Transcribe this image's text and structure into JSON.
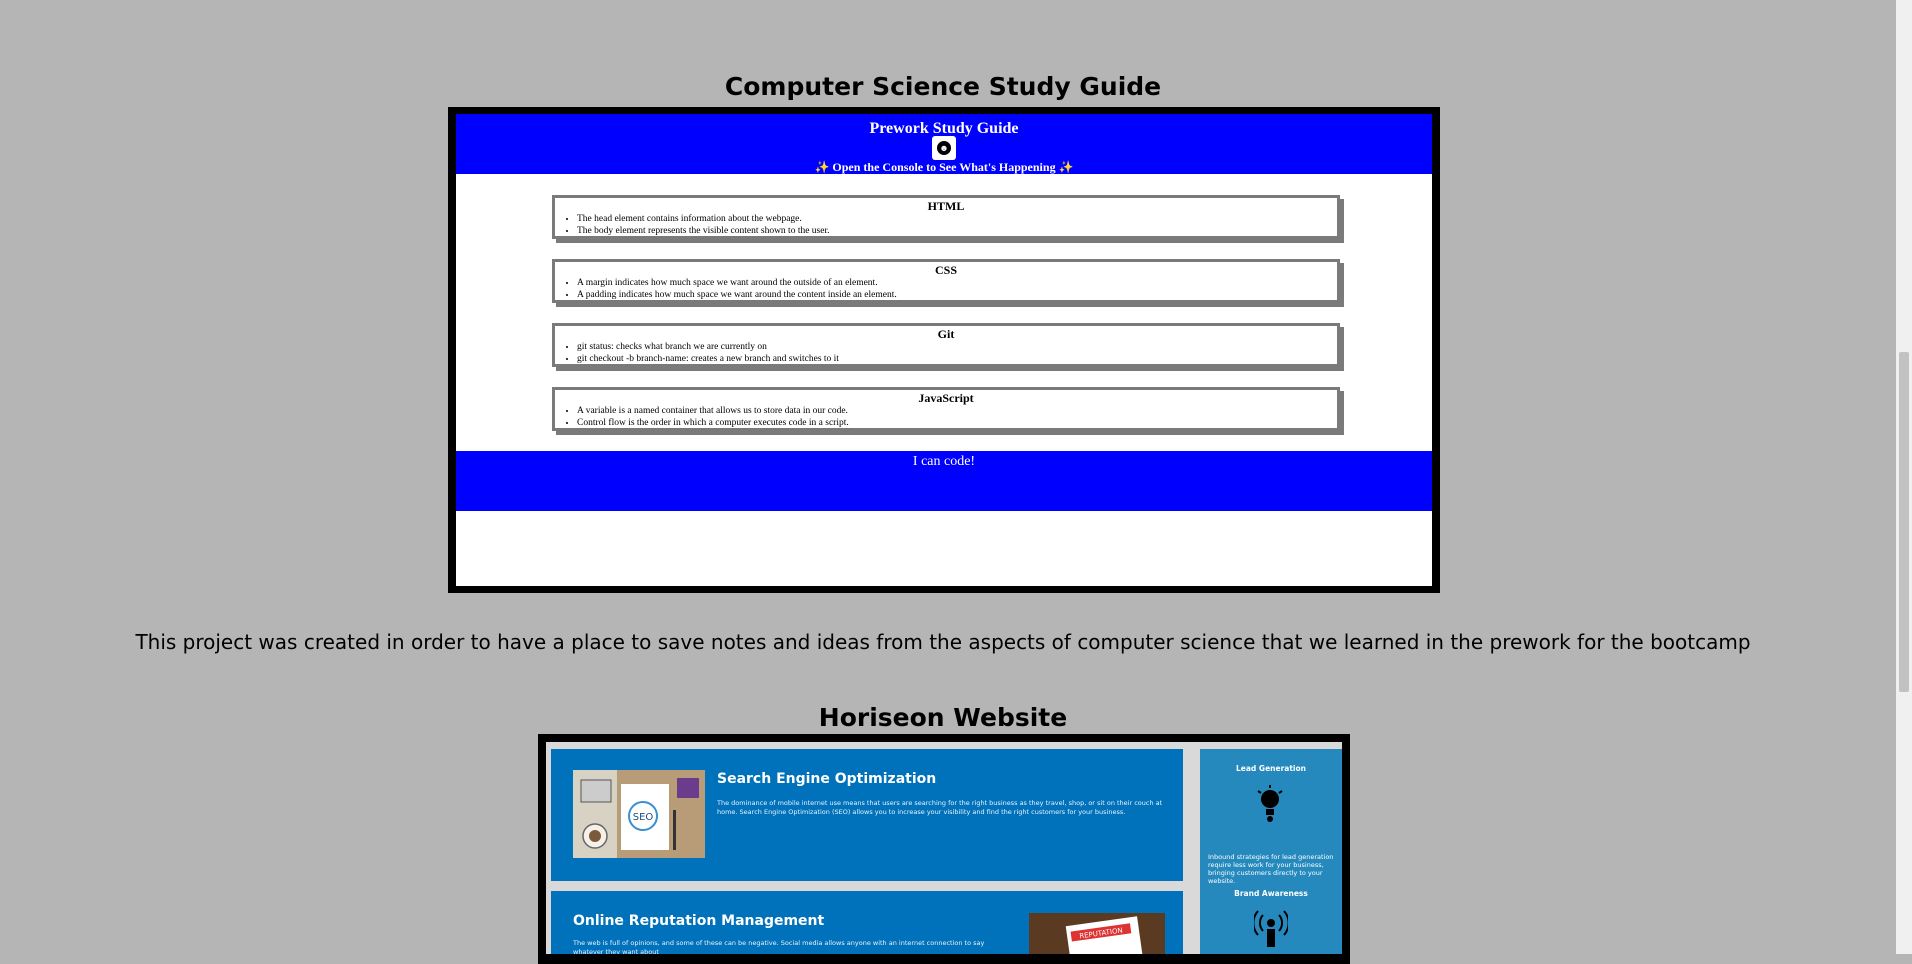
{
  "projects": [
    {
      "title": "Computer Science Study Guide",
      "preview": {
        "header_title": "Prework Study Guide",
        "header_subtitle": "✨ Open the Console to See What's Happening ✨",
        "cards": [
          {
            "title": "HTML",
            "items": [
              "The head element contains information about the webpage.",
              "The body element represents the visible content shown to the user."
            ]
          },
          {
            "title": "CSS",
            "items": [
              "A margin indicates how much space we want around the outside of an element.",
              "A padding indicates how much space we want around the content inside an element."
            ]
          },
          {
            "title": "Git",
            "items": [
              "git status: checks what branch we are currently on",
              "git checkout -b branch-name: creates a new branch and switches to it"
            ]
          },
          {
            "title": "JavaScript",
            "items": [
              "A variable is a named container that allows us to store data in our code.",
              "Control flow is the order in which a computer executes code in a script."
            ]
          }
        ],
        "footer_text": "I can code!"
      },
      "description": "This project was created in order to have a place to save notes and ideas from the aspects of computer science that we learned in the prework for the bootcamp"
    },
    {
      "title": "Horiseon Website",
      "preview": {
        "cards": [
          {
            "title": "Search Engine Optimization",
            "text": "The dominance of mobile internet use means that users are searching for the right business as they travel, shop, or sit on their couch at home. Search Engine Optimization (SEO) allows you to increase your visibility and find the right customers for your business."
          },
          {
            "title": "Online Reputation Management",
            "text": "The web is full of opinions, and some of these can be negative. Social media allows anyone with an internet connection to say whatever they want about"
          }
        ],
        "sidebar": [
          {
            "title": "Lead Generation",
            "text": "Inbound strategies for lead generation require less work for your business, bringing customers directly to your website."
          },
          {
            "title": "Brand Awareness",
            "text": ""
          }
        ],
        "image_labels": {
          "seo": "SEO",
          "reputation": "REPUTATION"
        }
      }
    }
  ],
  "colors": {
    "page_bg": "#b5b5b5",
    "study_blue": "#0000ff",
    "horiseon_blue": "#0072bb",
    "horiseon_side": "#2589bd"
  },
  "icons": {
    "logo": "skull-logo-icon",
    "lead": "lightbulb-icon",
    "brand": "broadcast-icon"
  }
}
